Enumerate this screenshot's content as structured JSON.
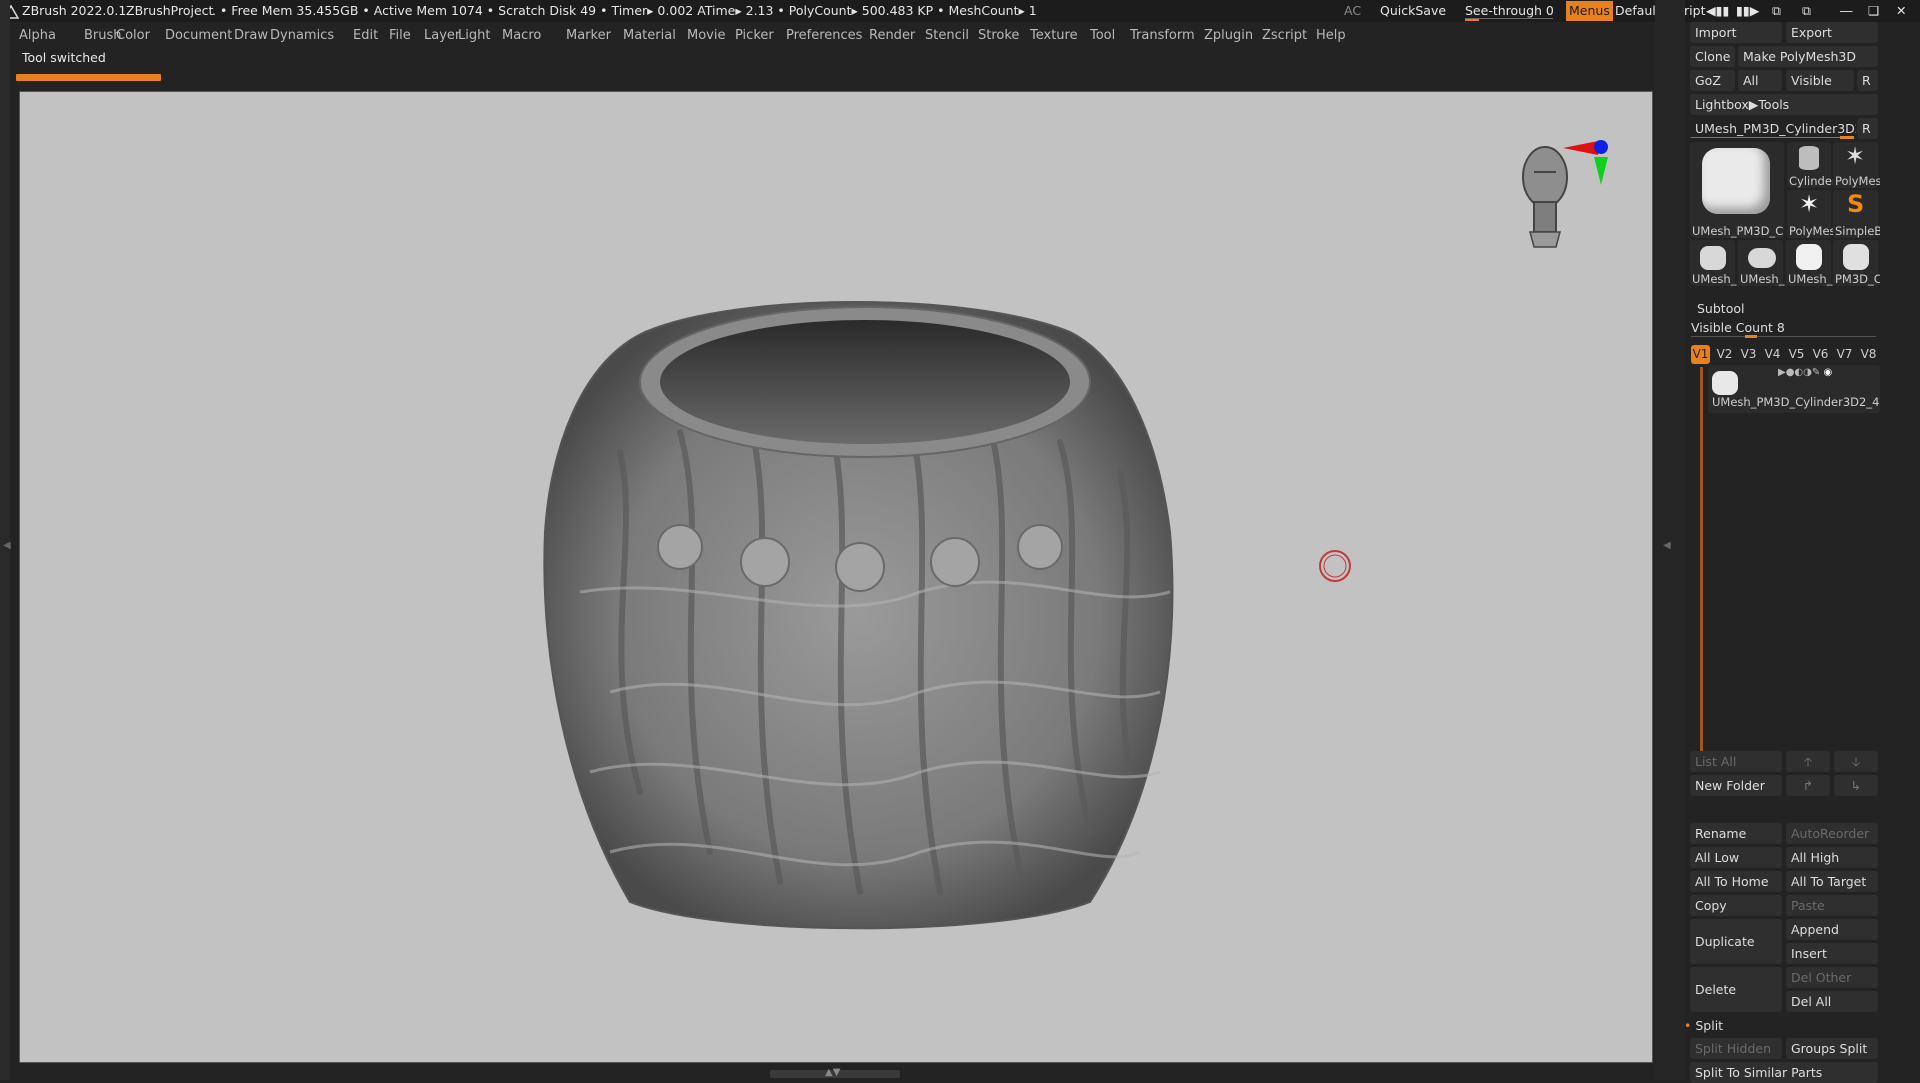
{
  "titlebar": {
    "app": "ZBrush 2022.0.1",
    "project": "ZBrushProject",
    "stats": ". • Free Mem 35.455GB • Active Mem 1074 • Scratch Disk 49 • Timer▸ 0.002 ATime▸ 2.13 • PolyCount▸ 500.483 KP • MeshCount▸ 1",
    "ac": "AC",
    "quicksave": "QuickSave",
    "see_through": "See-through   0",
    "menus": "Menus",
    "script": "DefaultZScript"
  },
  "menubar": {
    "items": [
      "Alpha",
      "Brush",
      "Color",
      "Document",
      "Draw",
      "Dynamics",
      "Edit",
      "File",
      "Layer",
      "Light",
      "Macro",
      "Marker",
      "Material",
      "Movie",
      "Picker",
      "Preferences",
      "Render",
      "Stencil",
      "Stroke",
      "Texture",
      "Tool",
      "Transform",
      "Zplugin",
      "Zscript",
      "Help"
    ]
  },
  "notice": "Tool switched",
  "tool_panel": {
    "import": "Import",
    "export": "Export",
    "clone": "Clone",
    "make_polymesh": "Make PolyMesh3D",
    "goz": "GoZ",
    "all": "All",
    "visible": "Visible",
    "r": "R",
    "lightbox": "Lightbox▶Tools",
    "current_tool": "UMesh_PM3D_Cylinder3D2_4",
    "thumbs": {
      "main": "UMesh_PM3D_C",
      "cylinder": "Cylinder",
      "polymesh1": "PolyMes",
      "polymesh2": "PolyMes",
      "simpleb": "SimpleB",
      "s1": "UMesh_",
      "s2": "UMesh_",
      "s3": "UMesh_",
      "s4": "PM3D_C"
    }
  },
  "subtool": {
    "title": "Subtool",
    "visible_count": "Visible Count 8",
    "tabs": [
      "V1",
      "V2",
      "V3",
      "V4",
      "V5",
      "V6",
      "V7",
      "V8"
    ],
    "active_tab": "V1",
    "item_name": "UMesh_PM3D_Cylinder3D2_4",
    "list_all": "List All",
    "new_folder": "New Folder",
    "rename": "Rename",
    "autoreorder": "AutoReorder",
    "all_low": "All Low",
    "all_high": "All High",
    "all_to_home": "All To Home",
    "all_to_target": "All To Target",
    "copy": "Copy",
    "paste": "Paste",
    "duplicate": "Duplicate",
    "append": "Append",
    "insert": "Insert",
    "delete": "Delete",
    "del_other": "Del Other",
    "del_all": "Del All",
    "split": "Split",
    "split_hidden": "Split Hidden",
    "groups_split": "Groups Split",
    "split_similar": "Split To Similar Parts"
  },
  "colors": {
    "accent": "#e8801e",
    "viewport_bg": "#c2c2c2",
    "ui_bg": "#232323"
  }
}
